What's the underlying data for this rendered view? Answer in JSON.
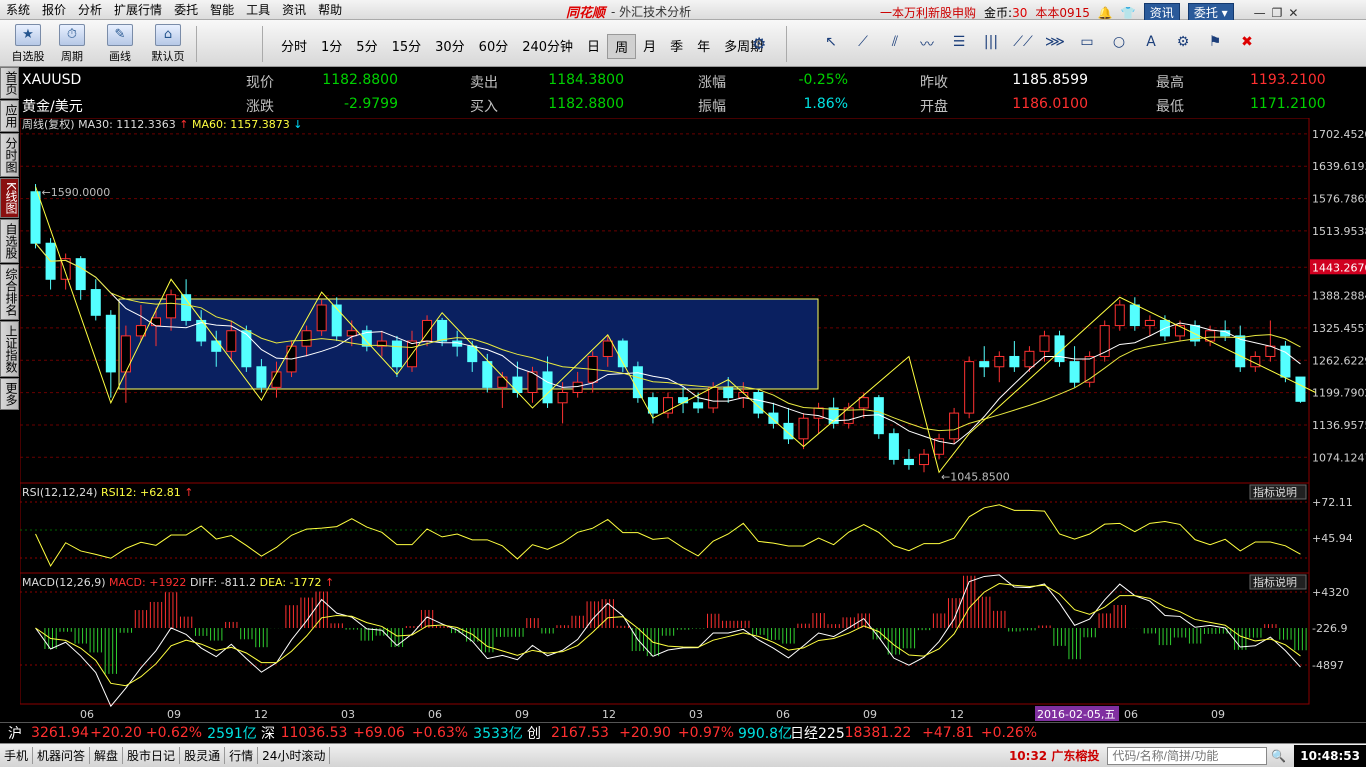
{
  "menu": [
    "系统",
    "报价",
    "分析",
    "扩展行情",
    "委托",
    "智能",
    "工具",
    "资讯",
    "帮助"
  ],
  "app": {
    "logo": "同花顺",
    "title": "外汇技术分析"
  },
  "topright": {
    "ipo": "一本万利新股申购",
    "gold_label": "金币:",
    "gold": "30",
    "account": "本本0915",
    "news_btn": "资讯",
    "trade_btn": "委托"
  },
  "toolbar": {
    "big": [
      {
        "label": "自选股",
        "icon": "star-icon",
        "glyph": "★"
      },
      {
        "label": "周期",
        "icon": "period-icon",
        "glyph": "⏱"
      },
      {
        "label": "画线",
        "icon": "pen-icon",
        "glyph": "✎"
      },
      {
        "label": "默认页",
        "icon": "home-icon",
        "glyph": "⌂"
      }
    ],
    "periods": [
      "分时",
      "1分",
      "5分",
      "15分",
      "30分",
      "60分",
      "240分钟",
      "日",
      "周",
      "月",
      "季",
      "年",
      "多周期"
    ],
    "selected_period": "周"
  },
  "lefttabs": [
    {
      "label": "首页",
      "sel": false
    },
    {
      "label": "应用",
      "sel": false
    },
    {
      "label": "分时图",
      "sel": false
    },
    {
      "label": "K线图",
      "sel": true
    },
    {
      "label": "自选股",
      "sel": false
    },
    {
      "label": "综合排名",
      "sel": false
    },
    {
      "label": "上证指数",
      "sel": false
    },
    {
      "label": "更多",
      "sel": false
    }
  ],
  "quote": {
    "symbol": "XAUUSD",
    "name": "黄金/美元",
    "row1": [
      {
        "k": "现价",
        "v": "1182.8800",
        "c": "green"
      },
      {
        "k": "卖出",
        "v": "1184.3800",
        "c": "green"
      },
      {
        "k": "涨幅",
        "v": "-0.25%",
        "c": "green"
      },
      {
        "k": "昨收",
        "v": "1185.8599",
        "c": "white"
      },
      {
        "k": "最高",
        "v": "1193.2100",
        "c": "red"
      }
    ],
    "row2": [
      {
        "k": "涨跌",
        "v": "-2.9799",
        "c": "green"
      },
      {
        "k": "买入",
        "v": "1182.8800",
        "c": "green"
      },
      {
        "k": "振幅",
        "v": "1.86%",
        "c": "cyan"
      },
      {
        "k": "开盘",
        "v": "1186.0100",
        "c": "red"
      },
      {
        "k": "最低",
        "v": "1171.2100",
        "c": "green"
      }
    ]
  },
  "main_legend": {
    "title": "周线(复权)",
    "ma30_label": "MA30: 1112.3363",
    "ma60_label": "MA60: 1157.3873"
  },
  "rsi_legend": {
    "label": "RSI(12,12,24)",
    "value": "RSI12: +62.81",
    "button": "指标说明"
  },
  "macd_legend": {
    "label": "MACD(12,26,9)",
    "macd": "MACD: +1922",
    "diff": "DIFF: -811.2",
    "dea": "DEA: -1772",
    "button": "指标说明"
  },
  "chart_data": {
    "type": "candlestick",
    "price_axis": {
      "ticks": [
        1702.452,
        1639.6193,
        1576.7865,
        1513.9538,
        1443.267,
        1388.2884,
        1325.4557,
        1262.6229,
        1199.7902,
        1136.9575,
        1074.1247
      ],
      "highlight": "1443.2670",
      "range": [
        1030,
        1710
      ]
    },
    "annotations": {
      "high": "1590.0000",
      "low": "1045.8500"
    },
    "rsi_axis": {
      "ticks": [
        "+72.11",
        "+45.94"
      ]
    },
    "macd_axis": {
      "ticks": [
        "+4320",
        "-226.9",
        "-4897"
      ]
    },
    "x_labels": [
      "06",
      "09",
      "12",
      "03",
      "06",
      "09",
      "12",
      "03",
      "06",
      "09",
      "12",
      "2016-02-05,五",
      "06",
      "09"
    ],
    "candles": [
      [
        1590,
        1605,
        1480,
        1490
      ],
      [
        1490,
        1500,
        1400,
        1420
      ],
      [
        1420,
        1470,
        1400,
        1460
      ],
      [
        1460,
        1465,
        1380,
        1400
      ],
      [
        1400,
        1420,
        1340,
        1350
      ],
      [
        1350,
        1360,
        1190,
        1240
      ],
      [
        1240,
        1330,
        1180,
        1310
      ],
      [
        1310,
        1370,
        1300,
        1330
      ],
      [
        1330,
        1365,
        1290,
        1345
      ],
      [
        1345,
        1400,
        1320,
        1390
      ],
      [
        1390,
        1420,
        1330,
        1340
      ],
      [
        1340,
        1360,
        1290,
        1300
      ],
      [
        1300,
        1320,
        1250,
        1280
      ],
      [
        1280,
        1340,
        1260,
        1320
      ],
      [
        1320,
        1330,
        1240,
        1250
      ],
      [
        1250,
        1265,
        1200,
        1210
      ],
      [
        1210,
        1260,
        1190,
        1240
      ],
      [
        1240,
        1300,
        1230,
        1290
      ],
      [
        1290,
        1330,
        1270,
        1320
      ],
      [
        1320,
        1380,
        1310,
        1370
      ],
      [
        1370,
        1385,
        1300,
        1310
      ],
      [
        1310,
        1340,
        1290,
        1320
      ],
      [
        1320,
        1330,
        1280,
        1290
      ],
      [
        1290,
        1320,
        1270,
        1300
      ],
      [
        1300,
        1310,
        1230,
        1250
      ],
      [
        1250,
        1320,
        1240,
        1300
      ],
      [
        1300,
        1350,
        1290,
        1340
      ],
      [
        1340,
        1345,
        1290,
        1300
      ],
      [
        1300,
        1320,
        1270,
        1290
      ],
      [
        1290,
        1300,
        1240,
        1260
      ],
      [
        1260,
        1275,
        1200,
        1210
      ],
      [
        1210,
        1240,
        1170,
        1230
      ],
      [
        1230,
        1260,
        1190,
        1200
      ],
      [
        1200,
        1250,
        1180,
        1240
      ],
      [
        1240,
        1270,
        1170,
        1180
      ],
      [
        1180,
        1220,
        1140,
        1200
      ],
      [
        1200,
        1240,
        1190,
        1220
      ],
      [
        1220,
        1280,
        1200,
        1270
      ],
      [
        1270,
        1310,
        1250,
        1300
      ],
      [
        1300,
        1305,
        1240,
        1250
      ],
      [
        1250,
        1260,
        1180,
        1190
      ],
      [
        1190,
        1200,
        1140,
        1160
      ],
      [
        1160,
        1200,
        1150,
        1190
      ],
      [
        1190,
        1210,
        1160,
        1180
      ],
      [
        1180,
        1200,
        1160,
        1170
      ],
      [
        1170,
        1220,
        1160,
        1210
      ],
      [
        1210,
        1230,
        1180,
        1190
      ],
      [
        1190,
        1220,
        1170,
        1200
      ],
      [
        1200,
        1205,
        1150,
        1160
      ],
      [
        1160,
        1180,
        1130,
        1140
      ],
      [
        1140,
        1170,
        1100,
        1110
      ],
      [
        1110,
        1160,
        1090,
        1150
      ],
      [
        1150,
        1180,
        1120,
        1170
      ],
      [
        1170,
        1190,
        1130,
        1140
      ],
      [
        1140,
        1180,
        1130,
        1170
      ],
      [
        1170,
        1200,
        1150,
        1190
      ],
      [
        1190,
        1195,
        1110,
        1120
      ],
      [
        1120,
        1130,
        1060,
        1070
      ],
      [
        1070,
        1090,
        1050,
        1060
      ],
      [
        1060,
        1090,
        1045,
        1080
      ],
      [
        1080,
        1120,
        1070,
        1110
      ],
      [
        1110,
        1170,
        1100,
        1160
      ],
      [
        1160,
        1270,
        1150,
        1260
      ],
      [
        1260,
        1290,
        1230,
        1250
      ],
      [
        1250,
        1280,
        1220,
        1270
      ],
      [
        1270,
        1300,
        1240,
        1250
      ],
      [
        1250,
        1290,
        1240,
        1280
      ],
      [
        1280,
        1320,
        1260,
        1310
      ],
      [
        1310,
        1320,
        1250,
        1260
      ],
      [
        1260,
        1290,
        1210,
        1220
      ],
      [
        1220,
        1280,
        1210,
        1270
      ],
      [
        1270,
        1340,
        1260,
        1330
      ],
      [
        1330,
        1380,
        1320,
        1370
      ],
      [
        1370,
        1385,
        1320,
        1330
      ],
      [
        1330,
        1350,
        1310,
        1340
      ],
      [
        1340,
        1350,
        1300,
        1310
      ],
      [
        1310,
        1340,
        1300,
        1330
      ],
      [
        1330,
        1340,
        1290,
        1300
      ],
      [
        1300,
        1330,
        1290,
        1320
      ],
      [
        1320,
        1340,
        1300,
        1310
      ],
      [
        1310,
        1330,
        1240,
        1250
      ],
      [
        1250,
        1280,
        1240,
        1270
      ],
      [
        1270,
        1340,
        1260,
        1290
      ],
      [
        1290,
        1300,
        1220,
        1230
      ],
      [
        1230,
        1230,
        1180,
        1182.88
      ]
    ]
  },
  "status": [
    {
      "t": "沪",
      "c": "white"
    },
    {
      "t": "3261.94",
      "c": "red"
    },
    {
      "t": "+20.20",
      "c": "red"
    },
    {
      "t": "+0.62%",
      "c": "red"
    },
    {
      "t": "2591亿",
      "c": "cyan"
    },
    {
      "t": "深",
      "c": "white"
    },
    {
      "t": "11036.53",
      "c": "red"
    },
    {
      "t": "+69.06",
      "c": "red"
    },
    {
      "t": "+0.63%",
      "c": "red"
    },
    {
      "t": "3533亿",
      "c": "cyan"
    },
    {
      "t": "创",
      "c": "white"
    },
    {
      "t": "2167.53",
      "c": "red"
    },
    {
      "t": "+20.90",
      "c": "red"
    },
    {
      "t": "+0.97%",
      "c": "red"
    },
    {
      "t": "990.8亿",
      "c": "cyan"
    },
    {
      "t": "日经225",
      "c": "white"
    },
    {
      "t": "18381.22",
      "c": "red"
    },
    {
      "t": "+47.81",
      "c": "red"
    },
    {
      "t": "+0.26%",
      "c": "red"
    }
  ],
  "bottom": {
    "tabs": [
      "手机",
      "机器问答",
      "解盘",
      "股市日记",
      "股灵通",
      "行情",
      "24小时滚动"
    ],
    "ticker": "10:32 广东榕投",
    "search_placeholder": "代码/名称/简拼/功能",
    "clock": "10:48:53"
  }
}
